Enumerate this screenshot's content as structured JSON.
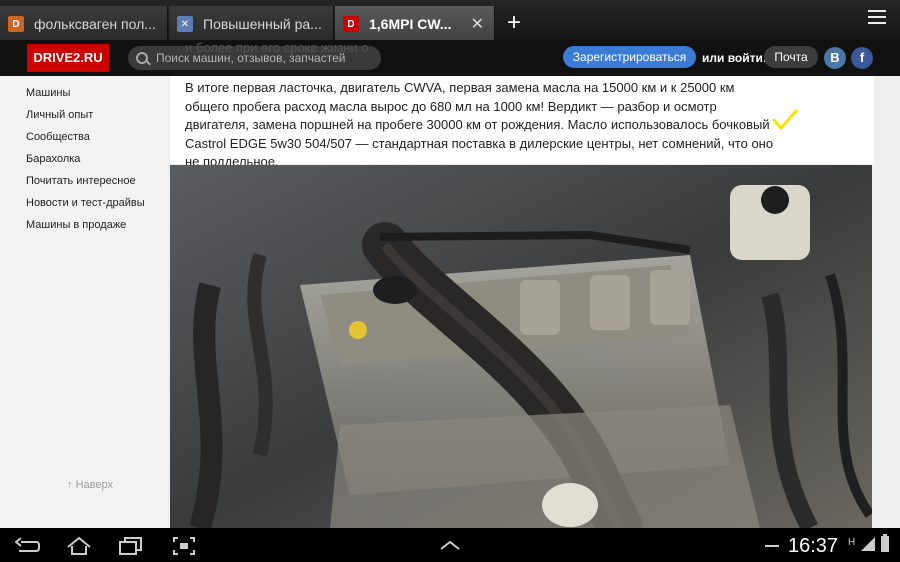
{
  "tabs": [
    {
      "label": "фольксваген пол...",
      "favicon": "drive2-icon",
      "color": "#cc2200"
    },
    {
      "label": "Повышенный ра...",
      "favicon": "generic-page-icon",
      "color": "#5b7fb5"
    },
    {
      "label": "1,6MPI CW...",
      "favicon": "drive2-icon",
      "color": "#cc0000",
      "active": true
    }
  ],
  "new_tab": "+",
  "header": {
    "logo": "DRIVE2.RU",
    "search_placeholder": "Поиск машин, отзывов, запчастей",
    "register": "Зарегистрироваться",
    "login_label": "или войти:",
    "mail": "Почта",
    "vk": "В",
    "fb": "f"
  },
  "sidebar": {
    "items": [
      "Машины",
      "Личный опыт",
      "Сообщества",
      "Барахолка",
      "Почитать интересное",
      "Новости и тест-драйвы",
      "Машины в продаже"
    ],
    "to_top": "Наверх"
  },
  "article": {
    "partial_line": "и более при его сроке жизни о",
    "text": "В итоге первая ласточка, двигатель CWVA, первая замена масла на 15000 км и к 25000 км общего пробега расход масла вырос до 680 мл на 1000 км! Вердикт — разбор и осмотр двигателя, замена поршней на пробеге 30000 км от рождения. Масло использовалось бочковый Castrol EDGE 5w30 504/507 — стандартная поставка в дилерские центры, нет сомнений, что оно не поддельное."
  },
  "status": {
    "time": "16:37",
    "network": "H"
  },
  "colors": {
    "accent": "#cc0000",
    "register_button": "#3a7bd5",
    "checkmark": "#f5e400"
  }
}
